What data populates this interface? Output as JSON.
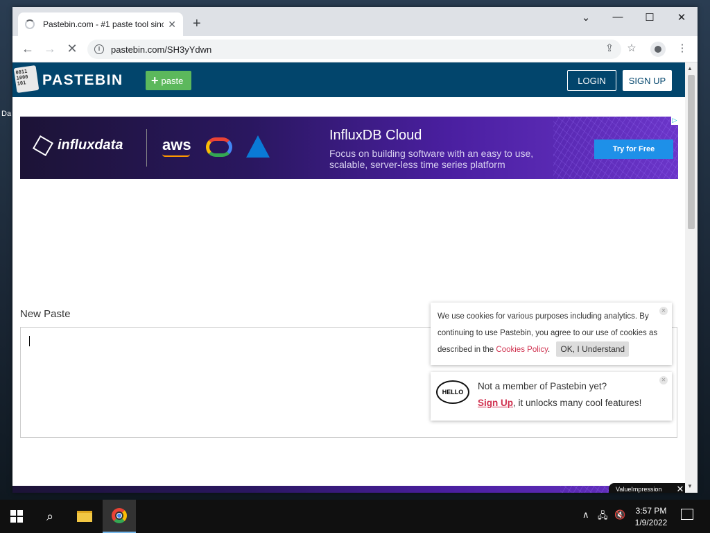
{
  "desktop": {
    "icon_label": "Da"
  },
  "browser": {
    "tab_title": "Pastebin.com - #1 paste tool since",
    "tab_close": "✕",
    "new_tab": "+",
    "url": "pastebin.com/SH3yYdwn",
    "window_controls": {
      "dropdown": "⌄",
      "minimize": "—",
      "maximize": "☐",
      "close": "✕"
    }
  },
  "pastebin": {
    "logo_bits": "0011 1000 101",
    "site_name": "PASTEBIN",
    "paste_button": "paste",
    "login": "LOGIN",
    "signup": "SIGN UP",
    "new_paste_label": "New Paste"
  },
  "ad": {
    "brand": "influxdata",
    "aws": "aws",
    "headline": "InfluxDB Cloud",
    "body": "Focus on building software with an easy to use, scalable, server-less time series platform",
    "cta": "Try for Free"
  },
  "cookie_notice": {
    "text": "We use cookies for various purposes including analytics. By continuing to use Pastebin, you agree to our use of cookies as described in the",
    "link": "Cookies Policy",
    "after_link": ".",
    "ok_button": "OK, I Understand"
  },
  "member_notice": {
    "bubble": "HELLO",
    "line1": "Not a member of Pastebin yet?",
    "signup_link": "Sign Up",
    "line2_rest": ", it unlocks many cool features!"
  },
  "ad_overlay": {
    "tag": "ValueImpression",
    "close": "✕"
  },
  "taskbar": {
    "time": "3:57 PM",
    "date": "1/9/2022"
  }
}
